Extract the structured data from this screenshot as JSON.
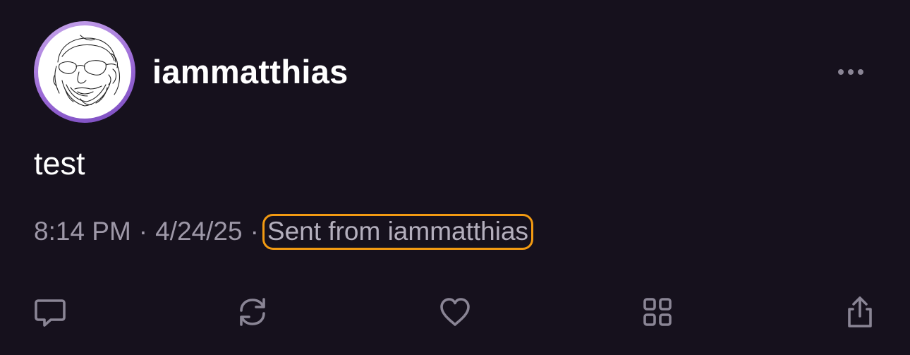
{
  "colors": {
    "background": "#16111d",
    "text_primary": "#ffffff",
    "text_muted": "#9e98a8",
    "icon_muted": "#8a8595",
    "avatar_ring": "#9b6ad6",
    "highlight_outline": "#f29a12"
  },
  "post": {
    "username": "iammatthias",
    "text": "test",
    "time": "8:14 PM",
    "date": "4/24/25",
    "separator": "·",
    "source_label": "Sent from iammatthias"
  },
  "icons": {
    "more": "ellipsis-horizontal-icon",
    "reply": "chat-bubble-icon",
    "repost": "repost-arrows-icon",
    "like": "heart-icon",
    "apps": "grid-icon",
    "share": "share-upload-icon"
  }
}
